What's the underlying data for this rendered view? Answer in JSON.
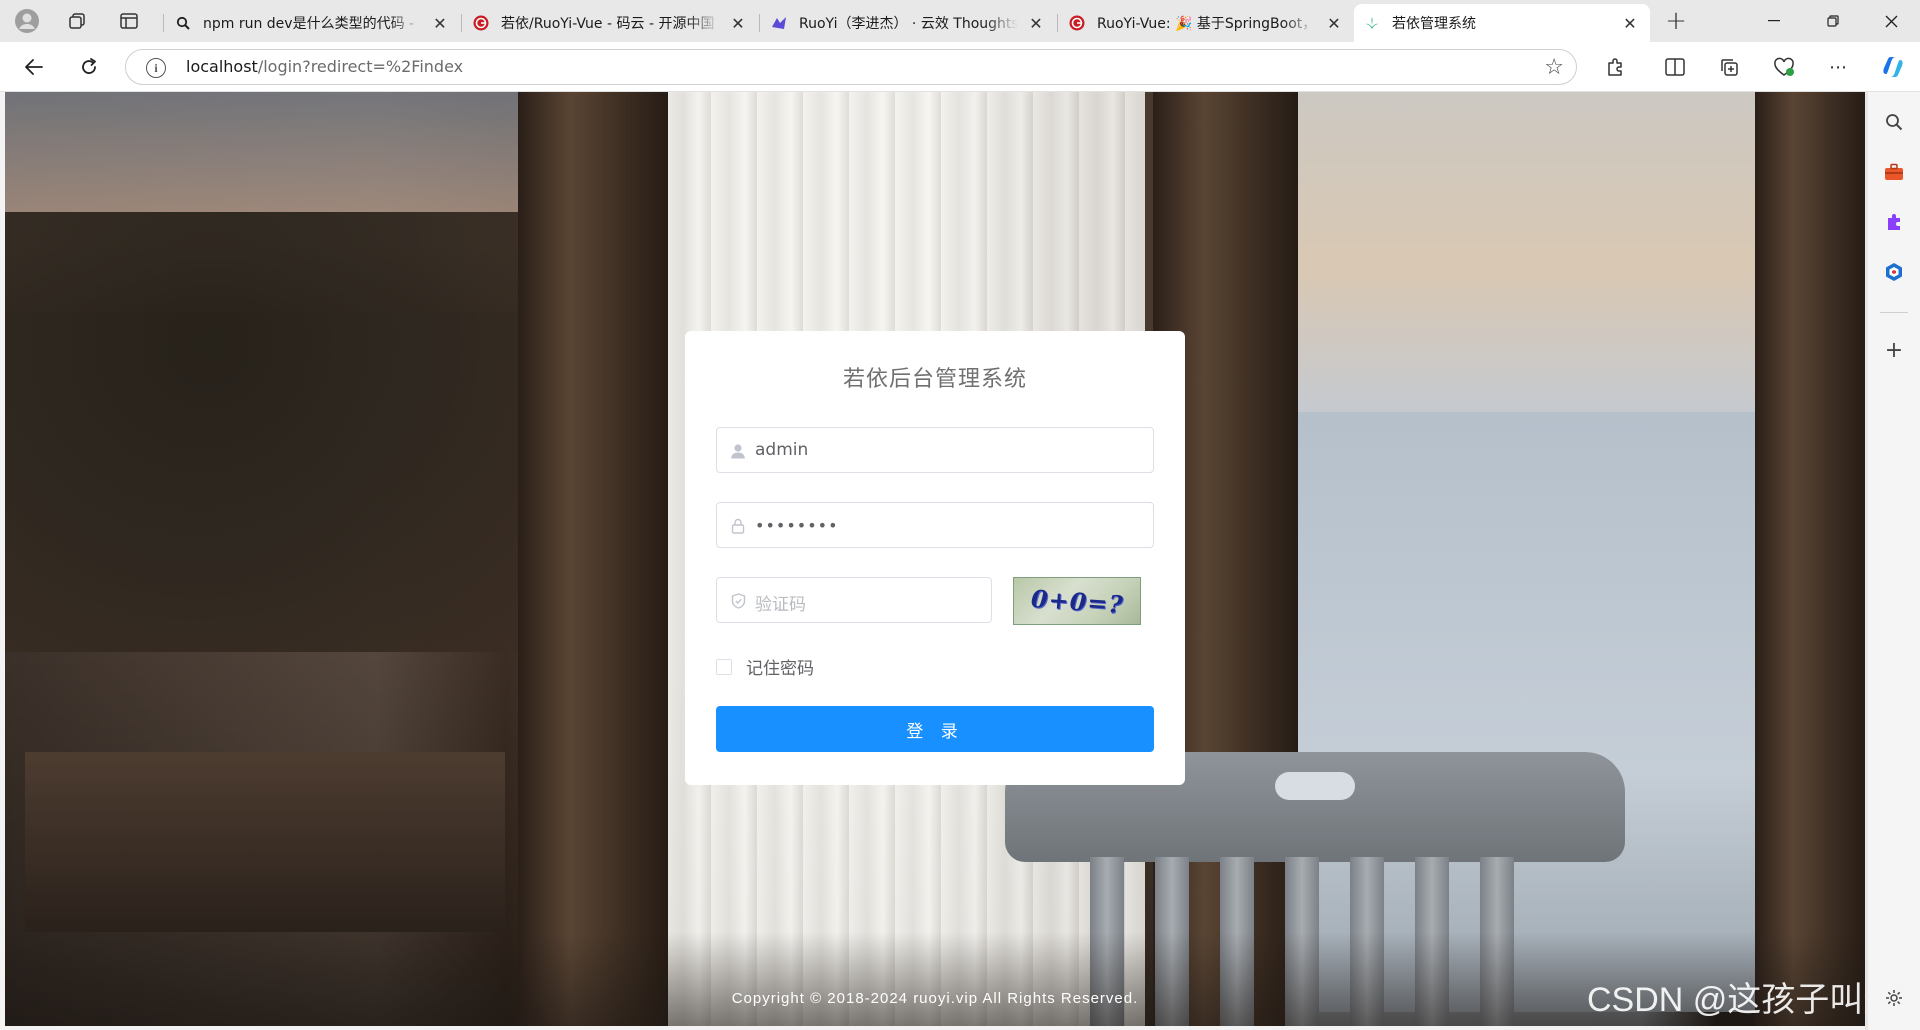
{
  "browser": {
    "tabs": [
      {
        "title": "npm run dev是什么类型的代码 -",
        "favicon": "search-icon",
        "active": false
      },
      {
        "title": "若依/RuoYi-Vue - 码云 - 开源中国",
        "favicon": "gitee-logo",
        "active": false
      },
      {
        "title": "RuoYi（李进杰） · 云效 Thoughts",
        "favicon": "thoughts-logo",
        "active": false
      },
      {
        "title": "RuoYi-Vue: 🎉 基于SpringBoot，",
        "favicon": "gitee-logo",
        "active": false
      },
      {
        "title": "若依管理系统",
        "favicon": "ruoyi-leaf-logo",
        "active": true
      }
    ],
    "new_tab_label": "+",
    "address_bar": {
      "host": "localhost",
      "path": "/login?redirect=%2Findex"
    }
  },
  "login": {
    "title": "若依后台管理系统",
    "username_value": "admin",
    "password_value": "••••••••",
    "captcha_placeholder": "验证码",
    "captcha_text": "0+0=?",
    "remember_label": "记住密码",
    "remember_checked": false,
    "submit_label": "登 录",
    "accent_color": "#1890ff"
  },
  "footer": {
    "copyright": "Copyright © 2018-2024 ruoyi.vip All Rights Reserved."
  },
  "watermark": "CSDN @这孩子叫逆"
}
